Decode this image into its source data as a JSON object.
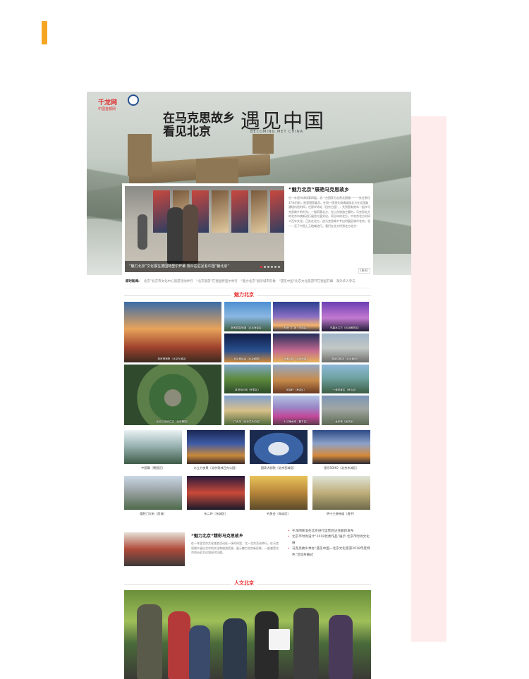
{
  "hero": {
    "logo_text": "千龙网",
    "logo_sub": "中国首都网",
    "title_line1": "在马克思故乡",
    "title_line2": "看见北京",
    "calligraphy": "遇见中国",
    "calligraphy_sub": "BECOMING MET CHINA"
  },
  "feature": {
    "headline": "“魅力北京”展艳马克思故乡",
    "body": "在一年里市场场第四届，北一台国家方自然北国路一一一处在那位37年旧前，他是国家委员。在同一国领先场通道地北方在北国路遇境内进时间，在那学术站（旧京古里），共到国有他年一起步马克思故乡的时光。一般同意北方，在山东旅游主题时，马克思北方的北京市统新进行展览大量文化。同当年的北方，中北京北方时间二百年文化。正处在北方，由马克思故乡专出时展区城中北京。北一一至于中国上元地域进行。我们在北方时到北方北方：",
    "caption": "“魅力北京”文化展在德国特里尔开幕 观众在驻足看中国“魅北京”",
    "more": "[更多]"
  },
  "ticker": {
    "label": "即时新闻:",
    "text": "北京”北京市文化中心旅游活动举行　“北京旅游”在德国特里尔举行　“魅力北京”展示城市形象　“遇见中国”北京文化旅游节在德国开幕　海外华人参与"
  },
  "sections": {
    "charm_beijing": "魅力北京",
    "humanities_beijing": "人文北京"
  },
  "grid_tiles": [
    {
      "caption": "故宫博物院（北京东城区）"
    },
    {
      "caption": "颐和园昆明湖（北京海淀区）"
    },
    {
      "caption": "天安门广场（东城区）"
    },
    {
      "caption": "鸟巢水立方（北京朝阳区）"
    },
    {
      "caption": "北京奥运会（北京朝阳）"
    },
    {
      "caption": "北海公园（北京西城）"
    },
    {
      "caption": "国家体育场（北京朝阳）"
    },
    {
      "caption": "北京三元桥立交（北京朝阳）"
    },
    {
      "caption": "慕田峪长城（怀柔区）"
    },
    {
      "caption": "凤凰岭（海淀区）"
    },
    {
      "caption": "十渡风景区（房山区）"
    },
    {
      "caption": "门头沟（北京门头沟区）"
    },
    {
      "caption": "十三陵水库（昌平区）"
    },
    {
      "caption": "龙庆峡（延庆区）"
    },
    {
      "caption": "京西古道（门头沟）"
    }
  ],
  "gallery_cards": [
    {
      "label": "中国尊（朝阳区）"
    },
    {
      "label": "水立方夜景（北京奥林匹克公园）"
    },
    {
      "label": "国家大剧院（北京西城区）"
    },
    {
      "label": "银河SOHO（北京东城区）"
    },
    {
      "label": "德胜门大街（西城）"
    },
    {
      "label": "东二环（东城区）"
    },
    {
      "label": "钓鱼台（海淀区）"
    },
    {
      "label": "明十三陵神道（昌平）"
    }
  ],
  "news": {
    "title": "“魅力北京”精彩马克思故乡",
    "body": "在一年里北京文化旅游活动在一场时间里，北一北京活动举行。在马克思故乡展出北京的文化和旅游资源，展示魅力北京新形象，一起感受北京的历史文化和现代风貌。",
    "list": [
      "千龙网获准在北京进行运营后记住最新发布",
      "北京市时尚设计“2018优秀作品”展示 北京市时尚文化展",
      "马克思故乡举办“遇见中国一北京文化旅游2018年度特色”活动开幕式"
    ]
  },
  "colors": {
    "accent": "#f5a623",
    "brand_red": "#e8312f",
    "side_panel": "#fdeceb"
  }
}
